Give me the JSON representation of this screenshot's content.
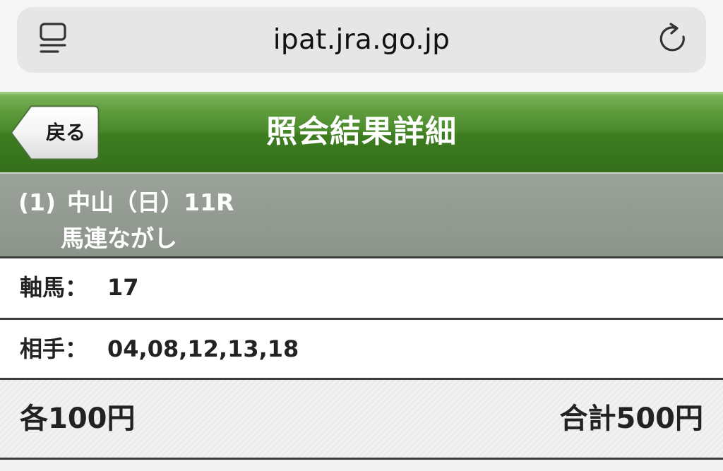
{
  "browser": {
    "url": "ipat.jra.go.jp"
  },
  "header": {
    "back_label": "戻る",
    "title": "照会結果詳細",
    "accent_color": "#3d7d20"
  },
  "race": {
    "number": "(1)",
    "venue": "中山（日）11R",
    "bet_type": "馬連ながし"
  },
  "bet": {
    "axis_label": "軸馬：",
    "axis_value": "17",
    "partner_label": "相手：",
    "partner_value": "04,08,12,13,18"
  },
  "amount": {
    "unit_price": "各100円",
    "total_price": "合計500円"
  }
}
